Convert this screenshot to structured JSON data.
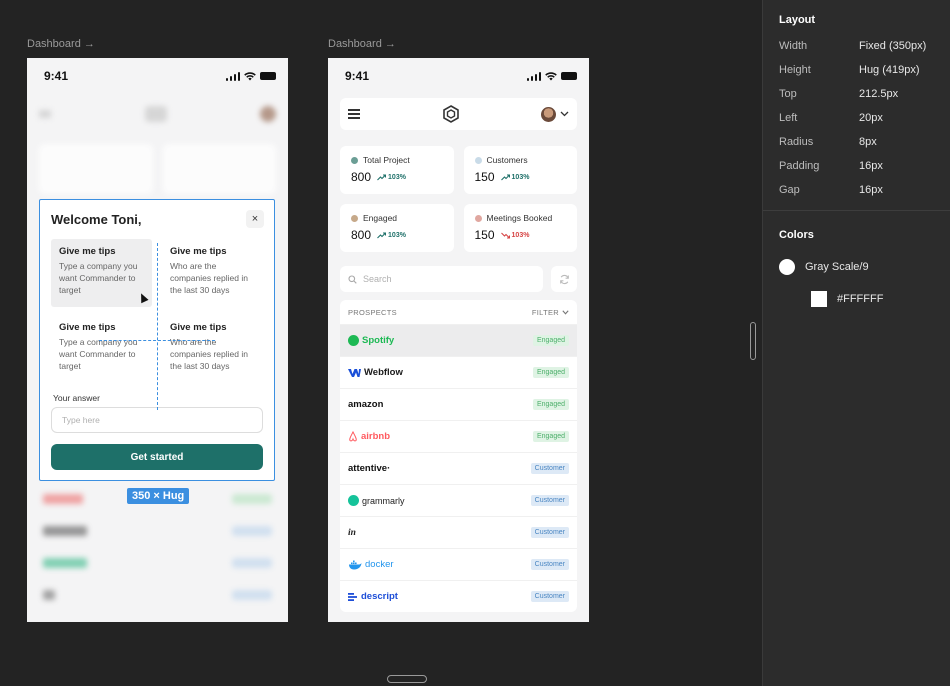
{
  "frames": {
    "left_label": "Dashboard →",
    "right_label": "Dashboard →"
  },
  "status_time": "9:41",
  "modal": {
    "title": "Welcome Toni,",
    "close": "×",
    "tips": [
      {
        "title": "Give me tips",
        "desc": "Type a company you want Commander to target"
      },
      {
        "title": "Give me tips",
        "desc": "Who are the companies replied in the last 30 days"
      },
      {
        "title": "Give me tips",
        "desc": "Type a company you want Commander to target"
      },
      {
        "title": "Give me tips",
        "desc": "Who are the companies replied in the last 30 days"
      }
    ],
    "answer_label": "Your answer",
    "answer_placeholder": "Type here",
    "cta": "Get started"
  },
  "dimension_tag": "350 × Hug",
  "stats": [
    {
      "label": "Total Project",
      "value": "800",
      "change": "103%",
      "dot": "#6b9e95",
      "trend": "up",
      "color": "#1e7069"
    },
    {
      "label": "Customers",
      "value": "150",
      "change": "103%",
      "dot": "#c9dbe8",
      "trend": "up",
      "color": "#1e7069"
    },
    {
      "label": "Engaged",
      "value": "800",
      "change": "103%",
      "dot": "#c6a98a",
      "trend": "up",
      "color": "#1e7069"
    },
    {
      "label": "Meetings Booked",
      "value": "150",
      "change": "103%",
      "dot": "#e0a7a0",
      "trend": "down",
      "color": "#d64545"
    }
  ],
  "search_placeholder": "Search",
  "list": {
    "header": "PROSPECTS",
    "filter": "FILTER",
    "rows": [
      {
        "name": "Spotify",
        "status": "Engaged",
        "color": "#1db954"
      },
      {
        "name": "Webflow",
        "status": "Engaged",
        "color": "#1a1a1a"
      },
      {
        "name": "amazon",
        "status": "Engaged",
        "color": "#111111"
      },
      {
        "name": "airbnb",
        "status": "Engaged",
        "color": "#ff5a5f"
      },
      {
        "name": "attentive·",
        "status": "Customer",
        "color": "#111111"
      },
      {
        "name": "grammarly",
        "status": "Customer",
        "color": "#15c39a"
      },
      {
        "name": "in",
        "status": "Customer",
        "color": "#222222"
      },
      {
        "name": "docker",
        "status": "Customer",
        "color": "#2496ed"
      },
      {
        "name": "descript",
        "status": "Customer",
        "color": "#1d4ed8"
      }
    ]
  },
  "panel": {
    "layout_title": "Layout",
    "props": [
      {
        "name": "Width",
        "value": "Fixed (350px)"
      },
      {
        "name": "Height",
        "value": "Hug (419px)"
      },
      {
        "name": "Top",
        "value": "212.5px"
      },
      {
        "name": "Left",
        "value": "20px"
      },
      {
        "name": "Radius",
        "value": "8px"
      },
      {
        "name": "Padding",
        "value": "16px"
      },
      {
        "name": "Gap",
        "value": "16px"
      }
    ],
    "colors_title": "Colors",
    "color_style": "Gray Scale/9",
    "color_hex": "#FFFFFF"
  }
}
